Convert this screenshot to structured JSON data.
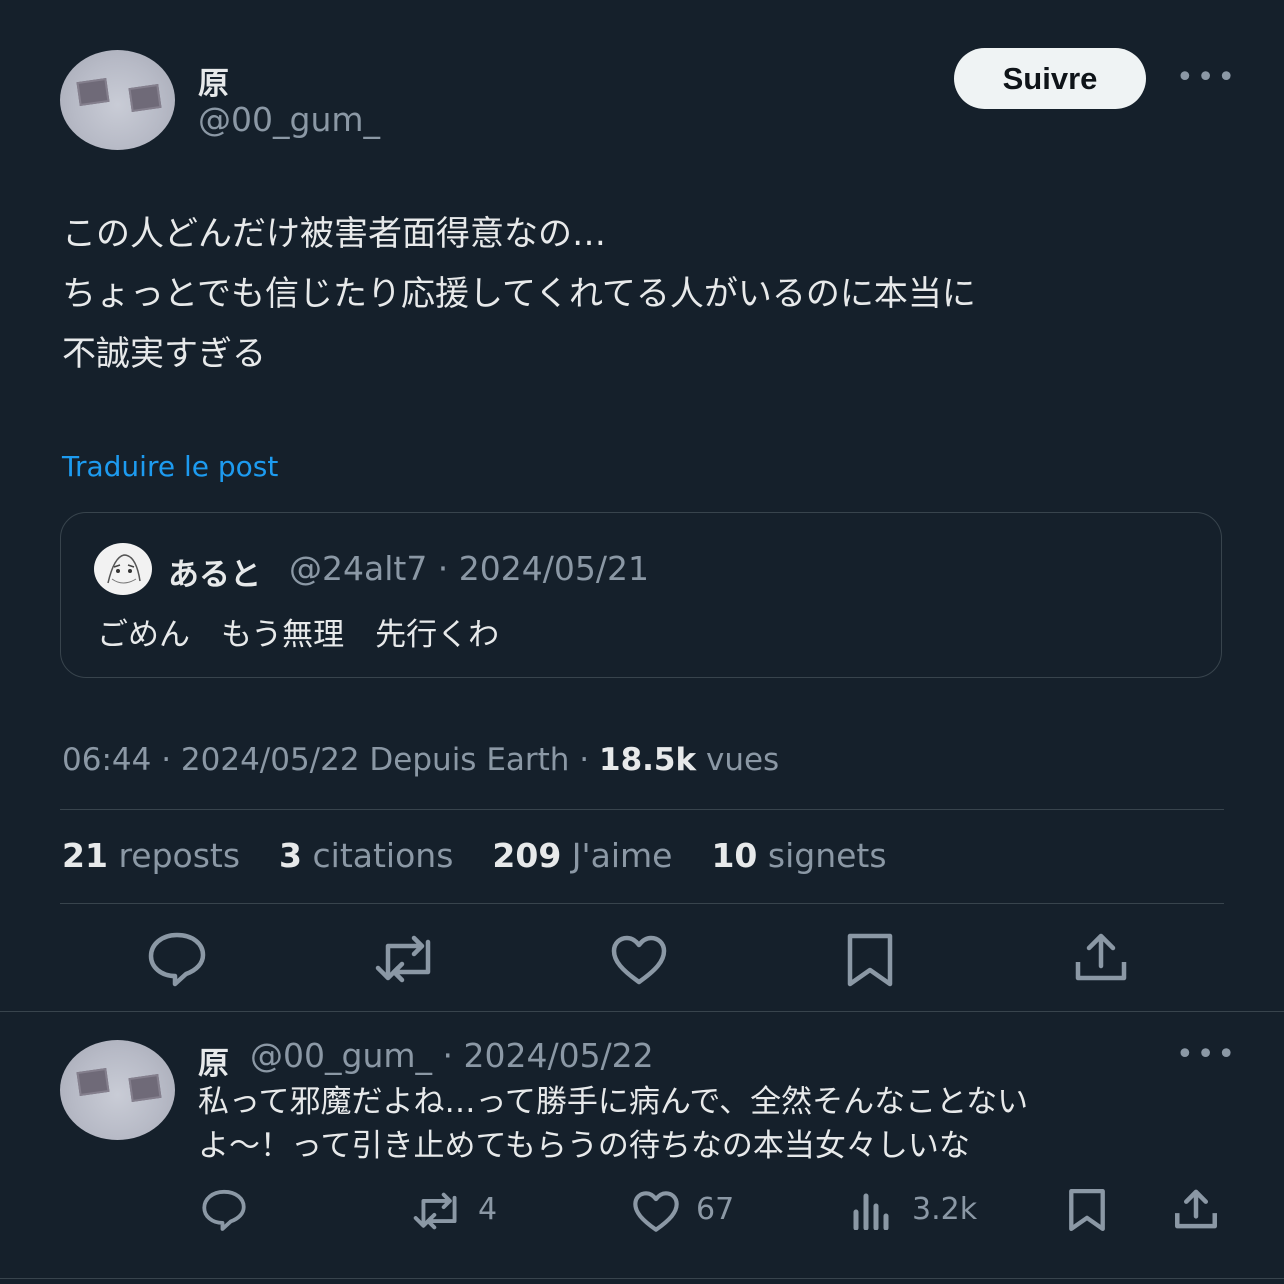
{
  "main_post": {
    "author_name": "原",
    "author_handle": "@00_gum_",
    "follow_label": "Suivre",
    "more_glyph": "•••",
    "text_lines": [
      "この人どんだけ被害者面得意なの…",
      "ちょっとでも信じたり応援してくれてる人がいるのに本当に",
      "不誠実すぎる"
    ],
    "translate_label": "Traduire le post",
    "quote": {
      "author_name": "あると",
      "handle_date": "@24alt7 · 2024/05/21",
      "text": "ごめん　もう無理　先行くわ"
    },
    "meta": {
      "time_date": "06:44 · 2024/05/22 Depuis Earth ·",
      "views_count": "18.5k",
      "views_label": "vues"
    },
    "stats": [
      {
        "count": "21",
        "label": "reposts"
      },
      {
        "count": "3",
        "label": "citations"
      },
      {
        "count": "209",
        "label": "J'aime"
      },
      {
        "count": "10",
        "label": "signets"
      }
    ],
    "actions": [
      "reply-icon",
      "repost-icon",
      "like-icon",
      "bookmark-icon",
      "share-icon"
    ]
  },
  "reply_post": {
    "author_name": "原",
    "handle_date": "@00_gum_ · 2024/05/22",
    "more_glyph": "•••",
    "text_lines": [
      "私って邪魔だよね…って勝手に病んで、全然そんなことない",
      "よ〜！って引き止めてもらうの待ちなの本当女々しいな"
    ],
    "actions": {
      "reposts": "4",
      "likes": "67",
      "views": "3.2k"
    }
  },
  "colors": {
    "background": "#15202b",
    "text": "#e7e9ea",
    "muted": "#8b98a5",
    "accent": "#1d9bf0",
    "border": "#38444d"
  }
}
